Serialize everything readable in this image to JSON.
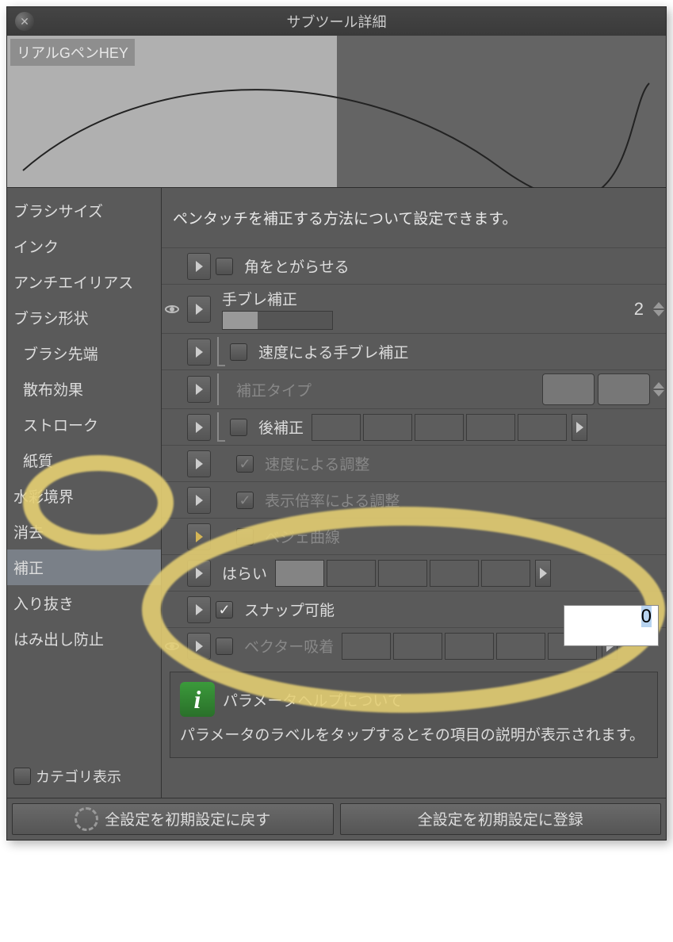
{
  "title": "サブツール詳細",
  "tool_name": "リアルGペンHEY",
  "sidebar": {
    "items": [
      {
        "label": "ブラシサイズ",
        "indent": false
      },
      {
        "label": "インク",
        "indent": false
      },
      {
        "label": "アンチエイリアス",
        "indent": false
      },
      {
        "label": "ブラシ形状",
        "indent": false
      },
      {
        "label": "ブラシ先端",
        "indent": true
      },
      {
        "label": "散布効果",
        "indent": true
      },
      {
        "label": "ストローク",
        "indent": true
      },
      {
        "label": "紙質",
        "indent": true
      },
      {
        "label": "水彩境界",
        "indent": false
      },
      {
        "label": "消去",
        "indent": false
      },
      {
        "label": "補正",
        "indent": false,
        "selected": true
      },
      {
        "label": "入り抜き",
        "indent": false
      },
      {
        "label": "はみ出し防止",
        "indent": false
      }
    ],
    "footer_label": "カテゴリ表示"
  },
  "panel": {
    "description": "ペンタッチを補正する方法について設定できます。",
    "rows": {
      "sharpen": {
        "label": "角をとがらせる"
      },
      "stabilize": {
        "label": "手ブレ補正",
        "value": "2"
      },
      "speed_stabilize": {
        "label": "速度による手ブレ補正"
      },
      "correction_type": {
        "label": "補正タイプ"
      },
      "post_correction": {
        "label": "後補正"
      },
      "speed_adjust": {
        "label": "速度による調整"
      },
      "zoom_adjust": {
        "label": "表示倍率による調整"
      },
      "bezier": {
        "label": "ベジェ曲線"
      },
      "taper": {
        "label": "はらい",
        "value": "0"
      },
      "snap": {
        "label": "スナップ可能"
      },
      "vector_snap": {
        "label": "ベクター吸着"
      }
    }
  },
  "help": {
    "title": "パラメータヘルプについて",
    "text": "パラメータのラベルをタップするとその項目の説明が表示されます。"
  },
  "footer": {
    "reset": "全設定を初期設定に戻す",
    "register": "全設定を初期設定に登録"
  }
}
